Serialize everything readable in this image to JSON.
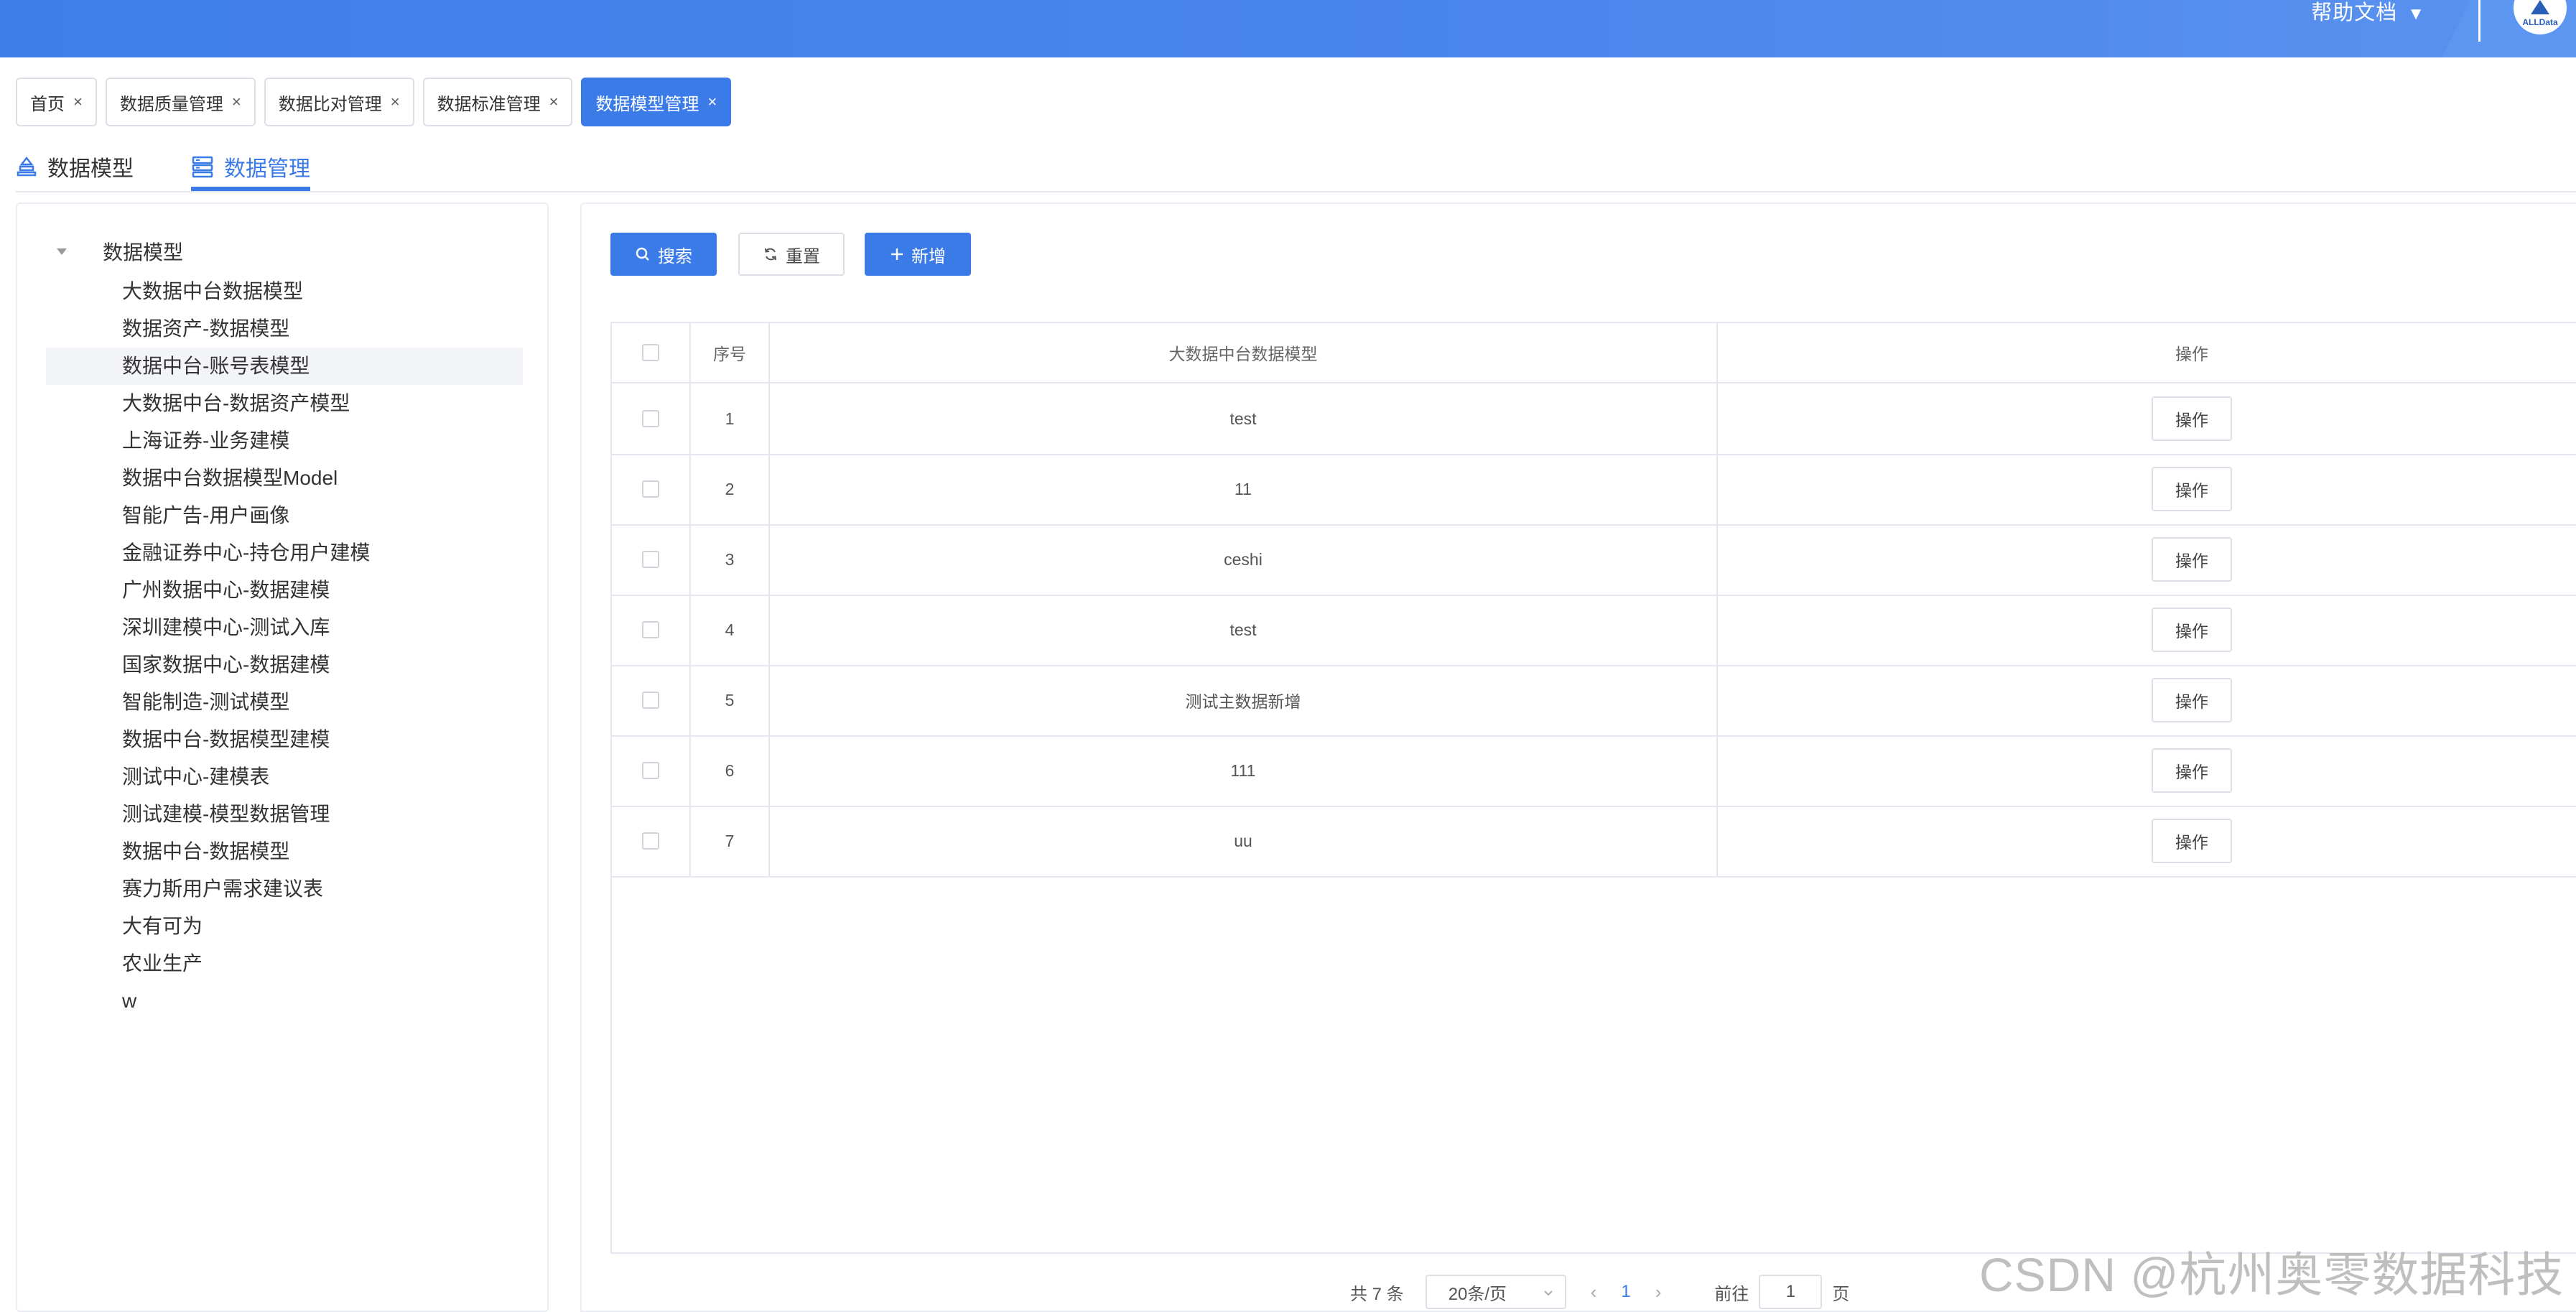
{
  "header": {
    "help_label": "帮助文档",
    "help_caret": "▼",
    "avatar_text": "ALLData"
  },
  "tabs": [
    {
      "label": "首页",
      "close": "×"
    },
    {
      "label": "数据质量管理",
      "close": "×"
    },
    {
      "label": "数据比对管理",
      "close": "×"
    },
    {
      "label": "数据标准管理",
      "close": "×"
    },
    {
      "label": "数据模型管理",
      "close": "×",
      "active": true
    }
  ],
  "subtabs": [
    {
      "label": "数据模型",
      "icon": "model-icon"
    },
    {
      "label": "数据管理",
      "icon": "data-manage-icon",
      "active": true
    }
  ],
  "tree": {
    "root": "数据模型",
    "items": [
      "大数据中台数据模型",
      "数据资产-数据模型",
      "数据中台-账号表模型",
      "大数据中台-数据资产模型",
      "上海证券-业务建模",
      "数据中台数据模型Model",
      "智能广告-用户画像",
      "金融证券中心-持仓用户建模",
      "广州数据中心-数据建模",
      "深圳建模中心-测试入库",
      "国家数据中心-数据建模",
      "智能制造-测试模型",
      "数据中台-数据模型建模",
      "测试中心-建模表",
      "测试建模-模型数据管理",
      "数据中台-数据模型",
      "赛力斯用户需求建议表",
      "大有可为",
      "农业生产",
      "w"
    ],
    "selected_index": 2
  },
  "toolbar": {
    "search_label": "搜索",
    "reset_label": "重置",
    "add_label": "新增"
  },
  "table": {
    "columns": [
      "序号",
      "大数据中台数据模型",
      "操作"
    ],
    "rows": [
      {
        "index": "1",
        "name": "test",
        "action": "操作"
      },
      {
        "index": "2",
        "name": "11",
        "action": "操作"
      },
      {
        "index": "3",
        "name": "ceshi",
        "action": "操作"
      },
      {
        "index": "4",
        "name": "test",
        "action": "操作"
      },
      {
        "index": "5",
        "name": "测试主数据新增",
        "action": "操作"
      },
      {
        "index": "6",
        "name": "111",
        "action": "操作"
      },
      {
        "index": "7",
        "name": "uu",
        "action": "操作"
      }
    ]
  },
  "pagination": {
    "total_label": "共 7 条",
    "page_size": "20条/页",
    "prev": "‹",
    "current": "1",
    "next": "›",
    "goto_label": "前往",
    "goto_value": "1",
    "page_suffix": "页"
  },
  "watermark": "CSDN @杭州奥零数据科技",
  "colors": {
    "primary": "#3a7be8",
    "header": "#3f7fe9",
    "border": "#e4e7ed"
  }
}
